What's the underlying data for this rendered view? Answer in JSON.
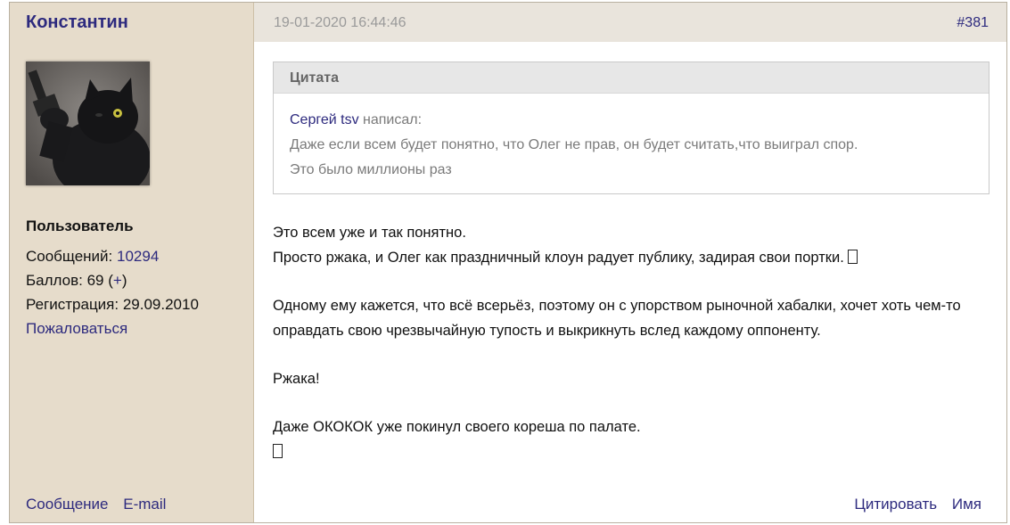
{
  "author": {
    "name": "Константин",
    "role": "Пользователь",
    "messages_label": "Сообщений:",
    "messages_count": "10294",
    "points_label": "Баллов: 69 (",
    "points_plus": "+",
    "points_close": ")",
    "registration": "Регистрация: 29.09.2010",
    "report_label": "Пожаловаться",
    "message_link": "Сообщение",
    "email_link": "E-mail"
  },
  "post": {
    "date": "19-01-2020 16:44:46",
    "number": "#381",
    "quote": {
      "header": "Цитата",
      "author": "Сергей tsv",
      "wrote": " написал:",
      "line1": "Даже если всем будет понятно, что Олег не прав, он будет считать,что выиграл спор.",
      "line2": "Это было миллионы раз"
    },
    "body": {
      "p1_line1": "Это всем уже и так понятно.",
      "p1_line2": "Просто ржака, и Олег как праздничный клоун радует публику, задирая свои портки.",
      "p2": "Одному ему кажется, что всё всерьёз, поэтому он с упорством рыночной хабалки, хочет хоть чем-то оправдать свою чрезвычайную тупость и выкрикнуть вслед каждому оппоненту.",
      "p3": "Ржака!",
      "p4": "Даже ОКОКОК уже покинул своего кореша по палате."
    },
    "actions": {
      "quote": "Цитировать",
      "name": "Имя"
    }
  }
}
